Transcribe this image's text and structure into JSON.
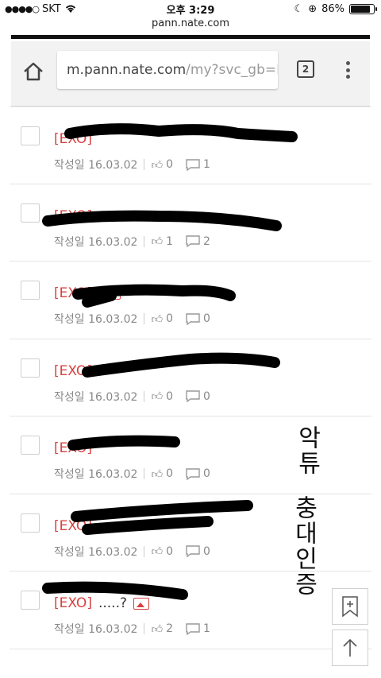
{
  "status_bar": {
    "carrier": "SKT",
    "time": "오후 3:29",
    "battery_percent": "86%",
    "battery_level": 0.86
  },
  "page_url_short": "pann.nate.com",
  "toolbar": {
    "address_main": "m.pann.nate.com",
    "address_dim": "/my?svc_gb=F&",
    "tab_count": "2"
  },
  "posts": [
    {
      "category": "[EXO]",
      "title": "",
      "date": "작성일 16.03.02",
      "likes": "0",
      "comments": "1",
      "has_image": false
    },
    {
      "category": "[EXO]",
      "title": "",
      "date": "작성일 16.03.02",
      "likes": "1",
      "comments": "2",
      "has_image": false
    },
    {
      "category": "[EXO]",
      "title": "",
      "date": "작성일 16.03.02",
      "likes": "0",
      "comments": "0",
      "has_image": true
    },
    {
      "category": "[EXO]",
      "title": "",
      "date": "작성일 16.03.02",
      "likes": "0",
      "comments": "0",
      "has_image": false
    },
    {
      "category": "[EXO]",
      "title": "",
      "date": "작성일 16.03.02",
      "likes": "0",
      "comments": "0",
      "has_image": false
    },
    {
      "category": "[EXO]",
      "title": "...",
      "date": "작성일 16.03.02",
      "likes": "0",
      "comments": "0",
      "has_image": false
    },
    {
      "category": "[EXO]",
      "title": ".....?",
      "date": "작성일 16.03.02",
      "likes": "2",
      "comments": "1",
      "has_image": true
    }
  ],
  "handwriting": {
    "line1": "악튜",
    "line2": "충대인증"
  },
  "icons": {
    "home": "home-icon",
    "menu": "more-vert-icon",
    "bookmark": "bookmark-add-icon",
    "scroll_top": "arrow-up-icon"
  }
}
